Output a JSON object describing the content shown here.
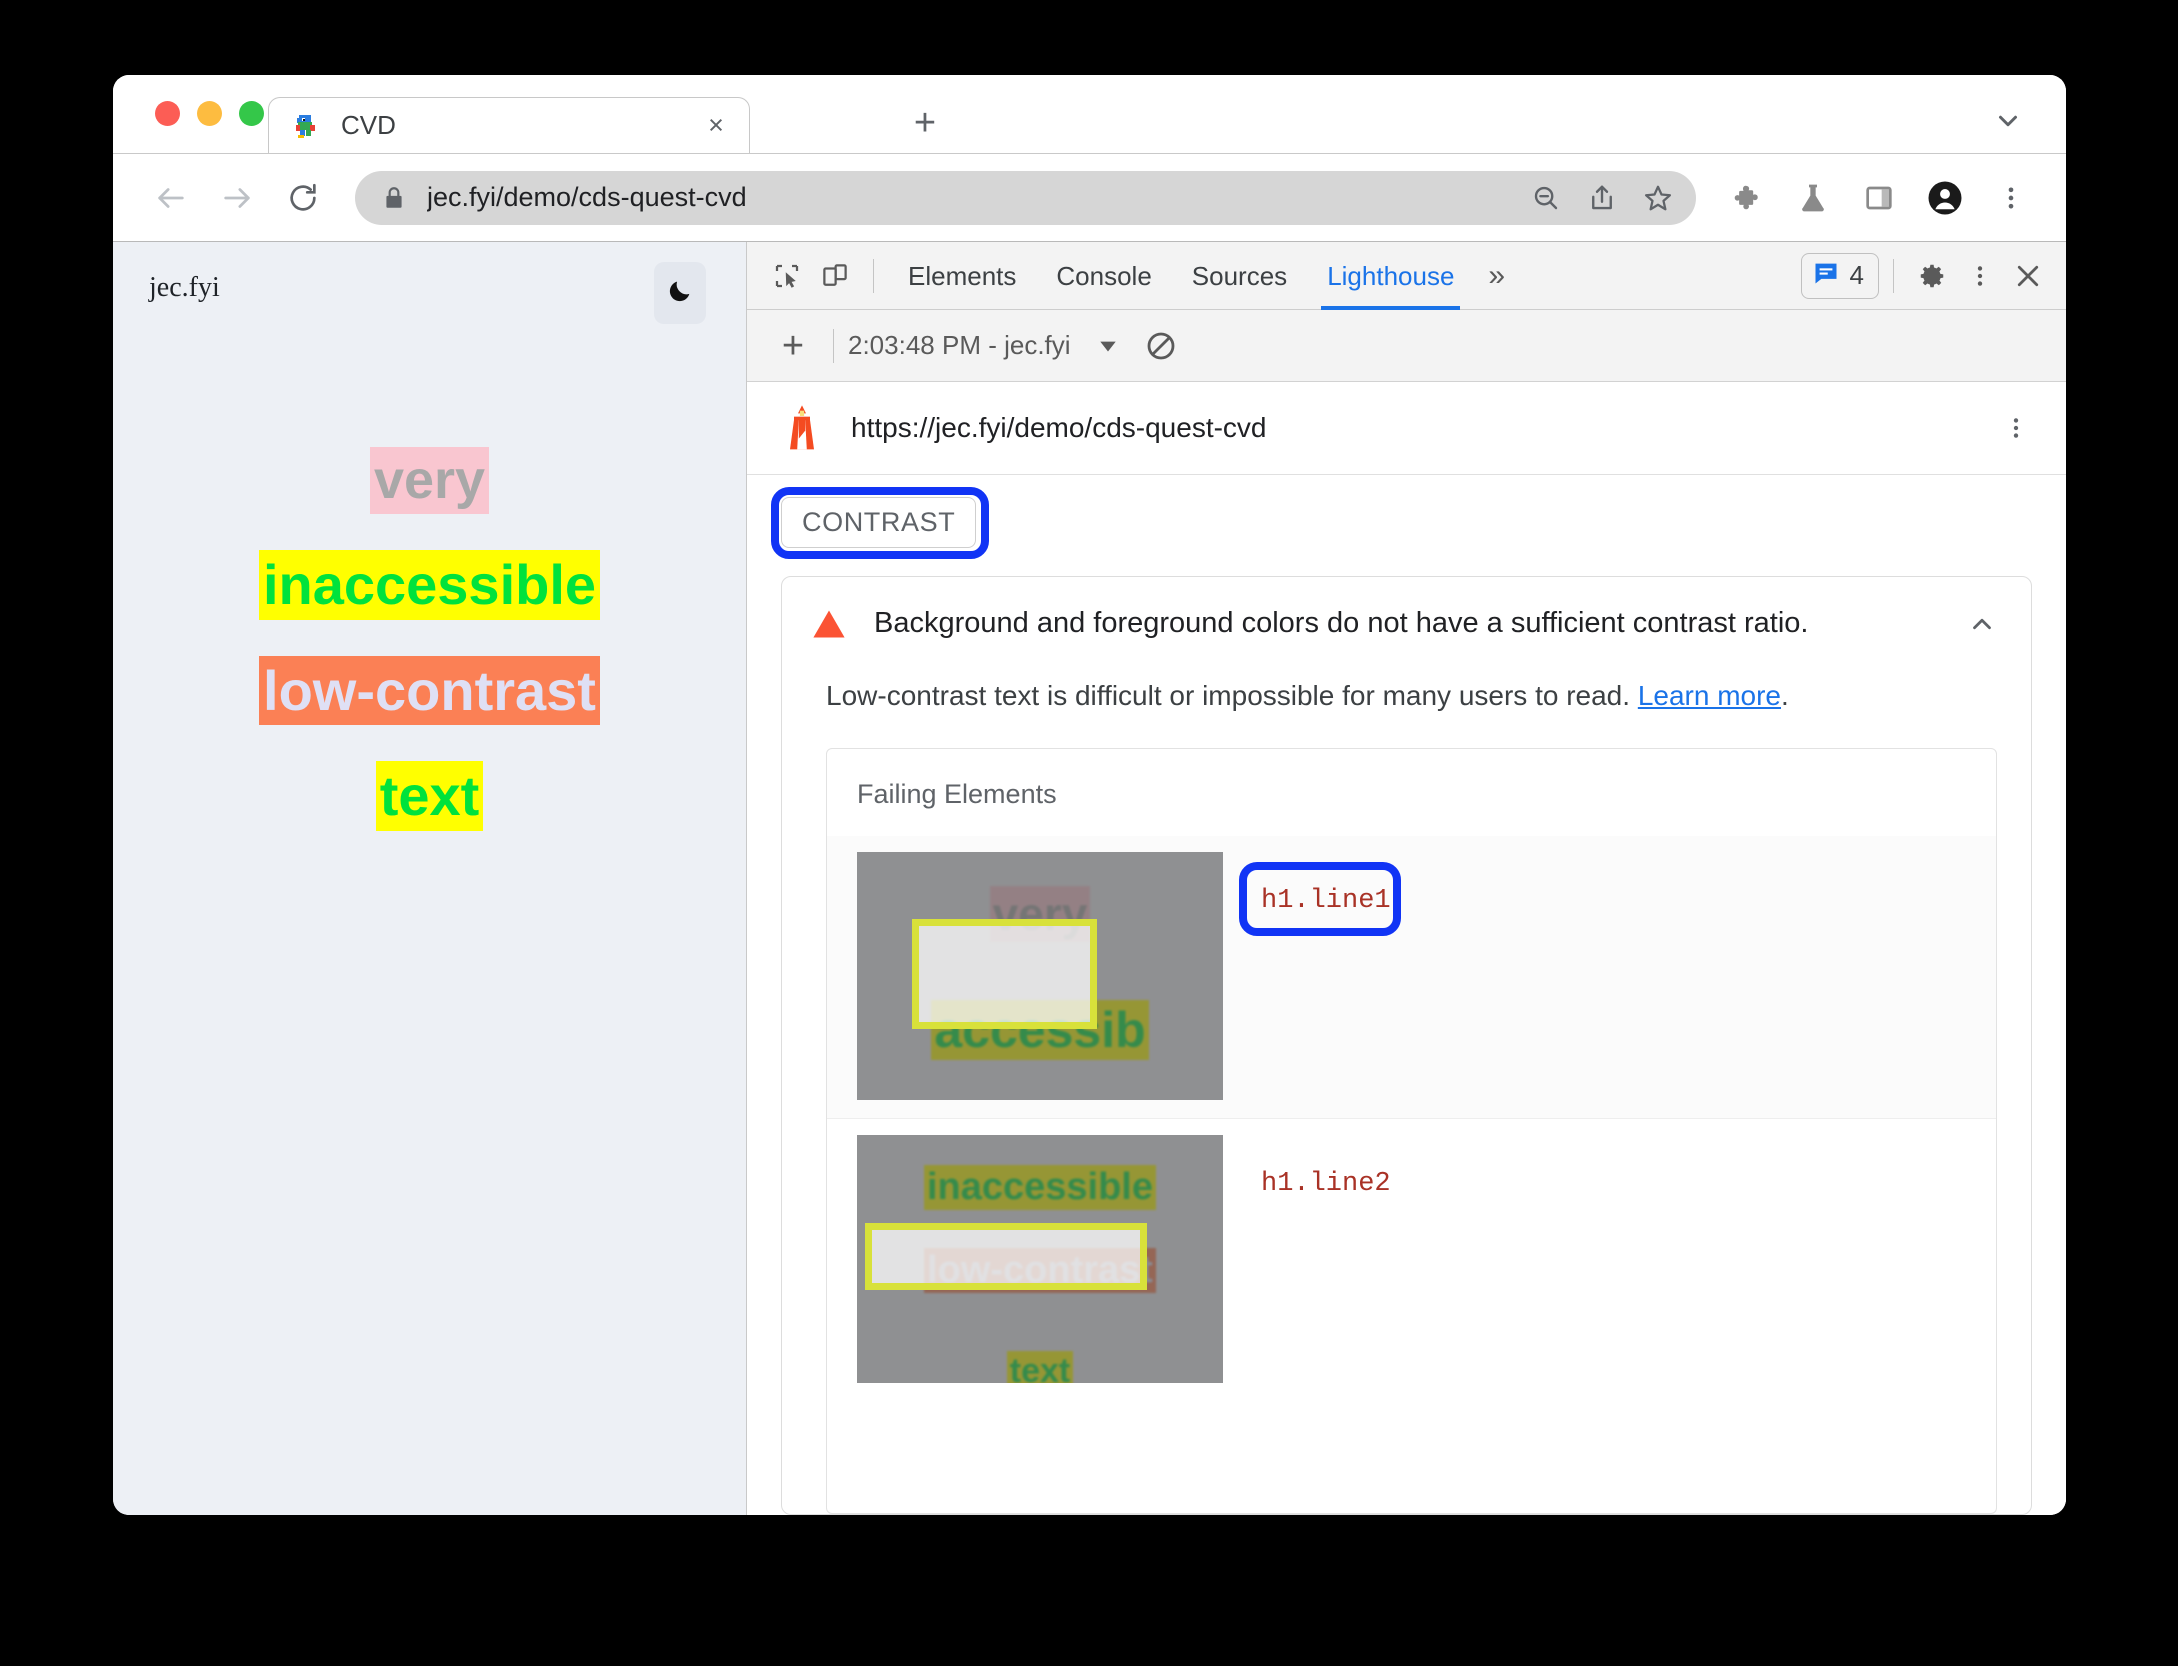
{
  "browser": {
    "tab": {
      "title": "CVD",
      "favicon": "dino-favicon",
      "close_label": "×"
    },
    "new_tab_label": "+",
    "tabstrip_chevron": "chevron-down-icon",
    "omnibox": {
      "url": "jec.fyi/demo/cds-quest-cvd",
      "lock": "lock-icon",
      "actions": [
        "zoom-out-icon",
        "share-icon",
        "bookmark-star-icon"
      ]
    },
    "toolbar_actions": [
      "extensions-puzzle-icon",
      "experiments-flask-icon",
      "side-panel-icon",
      "profile-avatar-icon",
      "browser-menu-icon"
    ],
    "nav": {
      "back": "back-arrow-icon",
      "forward": "forward-arrow-icon",
      "reload": "reload-icon"
    }
  },
  "page": {
    "site_name": "jec.fyi",
    "dark_mode_toggle": "moon-icon",
    "lines": [
      {
        "text": "very",
        "color": "#a8a8a8",
        "background": "#f9c6d0"
      },
      {
        "text": "inaccessible",
        "color": "#00e23c",
        "background": "#ffff00"
      },
      {
        "text": "low-contrast",
        "color": "#dfe0f5",
        "background": "#fb8055"
      },
      {
        "text": "text",
        "color": "#00e23c",
        "background": "#ffff00"
      }
    ]
  },
  "devtools": {
    "inspect_icon": "inspect-cursor-icon",
    "device_toggle_icon": "device-toolbar-icon",
    "tabs": [
      {
        "label": "Elements",
        "active": false
      },
      {
        "label": "Console",
        "active": false
      },
      {
        "label": "Sources",
        "active": false
      },
      {
        "label": "Lighthouse",
        "active": true
      }
    ],
    "overflow_label": "»",
    "message_badge": {
      "icon": "message-icon",
      "count": "4"
    },
    "settings_icon": "gear-icon",
    "more_icon": "more-vertical-icon",
    "close_icon": "close-icon"
  },
  "lighthouse": {
    "toolbar": {
      "add_label": "+",
      "run_label": "2:03:48 PM - jec.fyi",
      "dropdown_icon": "triangle-down-icon",
      "clear_icon": "no-entry-icon"
    },
    "report": {
      "logo": "lighthouse-icon",
      "url": "https://jec.fyi/demo/cds-quest-cvd",
      "menu_icon": "more-vertical-icon",
      "section_badge": "CONTRAST",
      "audit": {
        "warn_icon": "warning-triangle-icon",
        "title": "Background and foreground colors do not have a sufficient contrast ratio.",
        "collapse_icon": "chevron-up-icon",
        "description_before": "Low-contrast text is difficult or impossible for many users to read. ",
        "learn_more": "Learn more",
        "description_after": ".",
        "failing_title": "Failing Elements",
        "failing_elements": [
          {
            "selector": "h1.line1",
            "annotated": true
          },
          {
            "selector": "h1.line2",
            "annotated": false
          }
        ]
      }
    }
  },
  "annotations": {
    "color": "#1134f5",
    "targets": [
      "CONTRAST",
      "h1.line1"
    ]
  }
}
